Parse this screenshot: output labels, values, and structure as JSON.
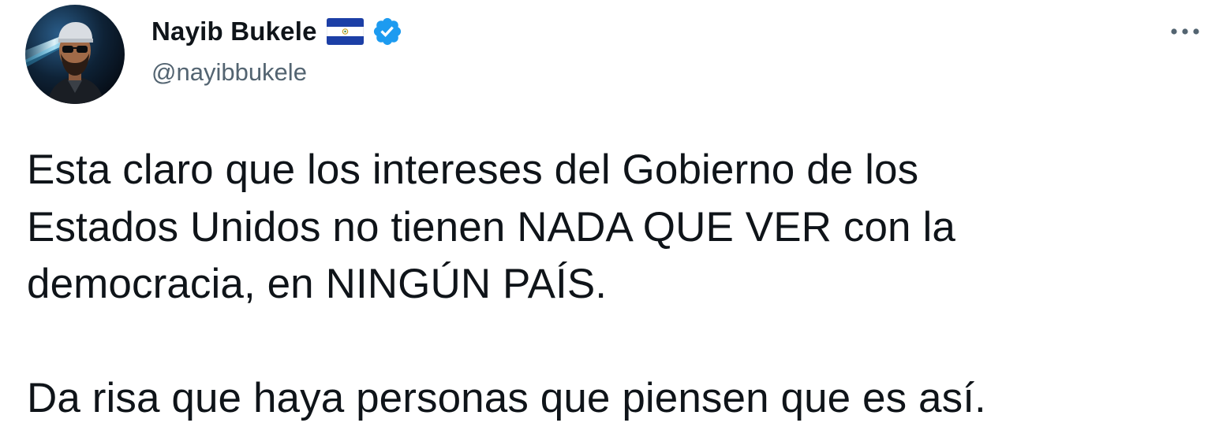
{
  "author": {
    "display_name": "Nayib Bukele",
    "handle": "@nayibbukele",
    "flag_icon": "el-salvador-flag-icon",
    "verified_icon": "verified-badge-icon",
    "verified_color": "#1d9bf0"
  },
  "menu": {
    "icon": "more-options-icon"
  },
  "tweet": {
    "lines": [
      "Esta claro que los intereses del Gobierno de los",
      "Estados Unidos no tienen NADA QUE VER con la",
      "democracia, en NINGÚN PAÍS.",
      "Da risa que haya personas que piensen que es así."
    ]
  },
  "colors": {
    "text": "#0f1419",
    "secondary": "#536471",
    "flag_blue": "#1c3fa6",
    "background": "#ffffff"
  }
}
